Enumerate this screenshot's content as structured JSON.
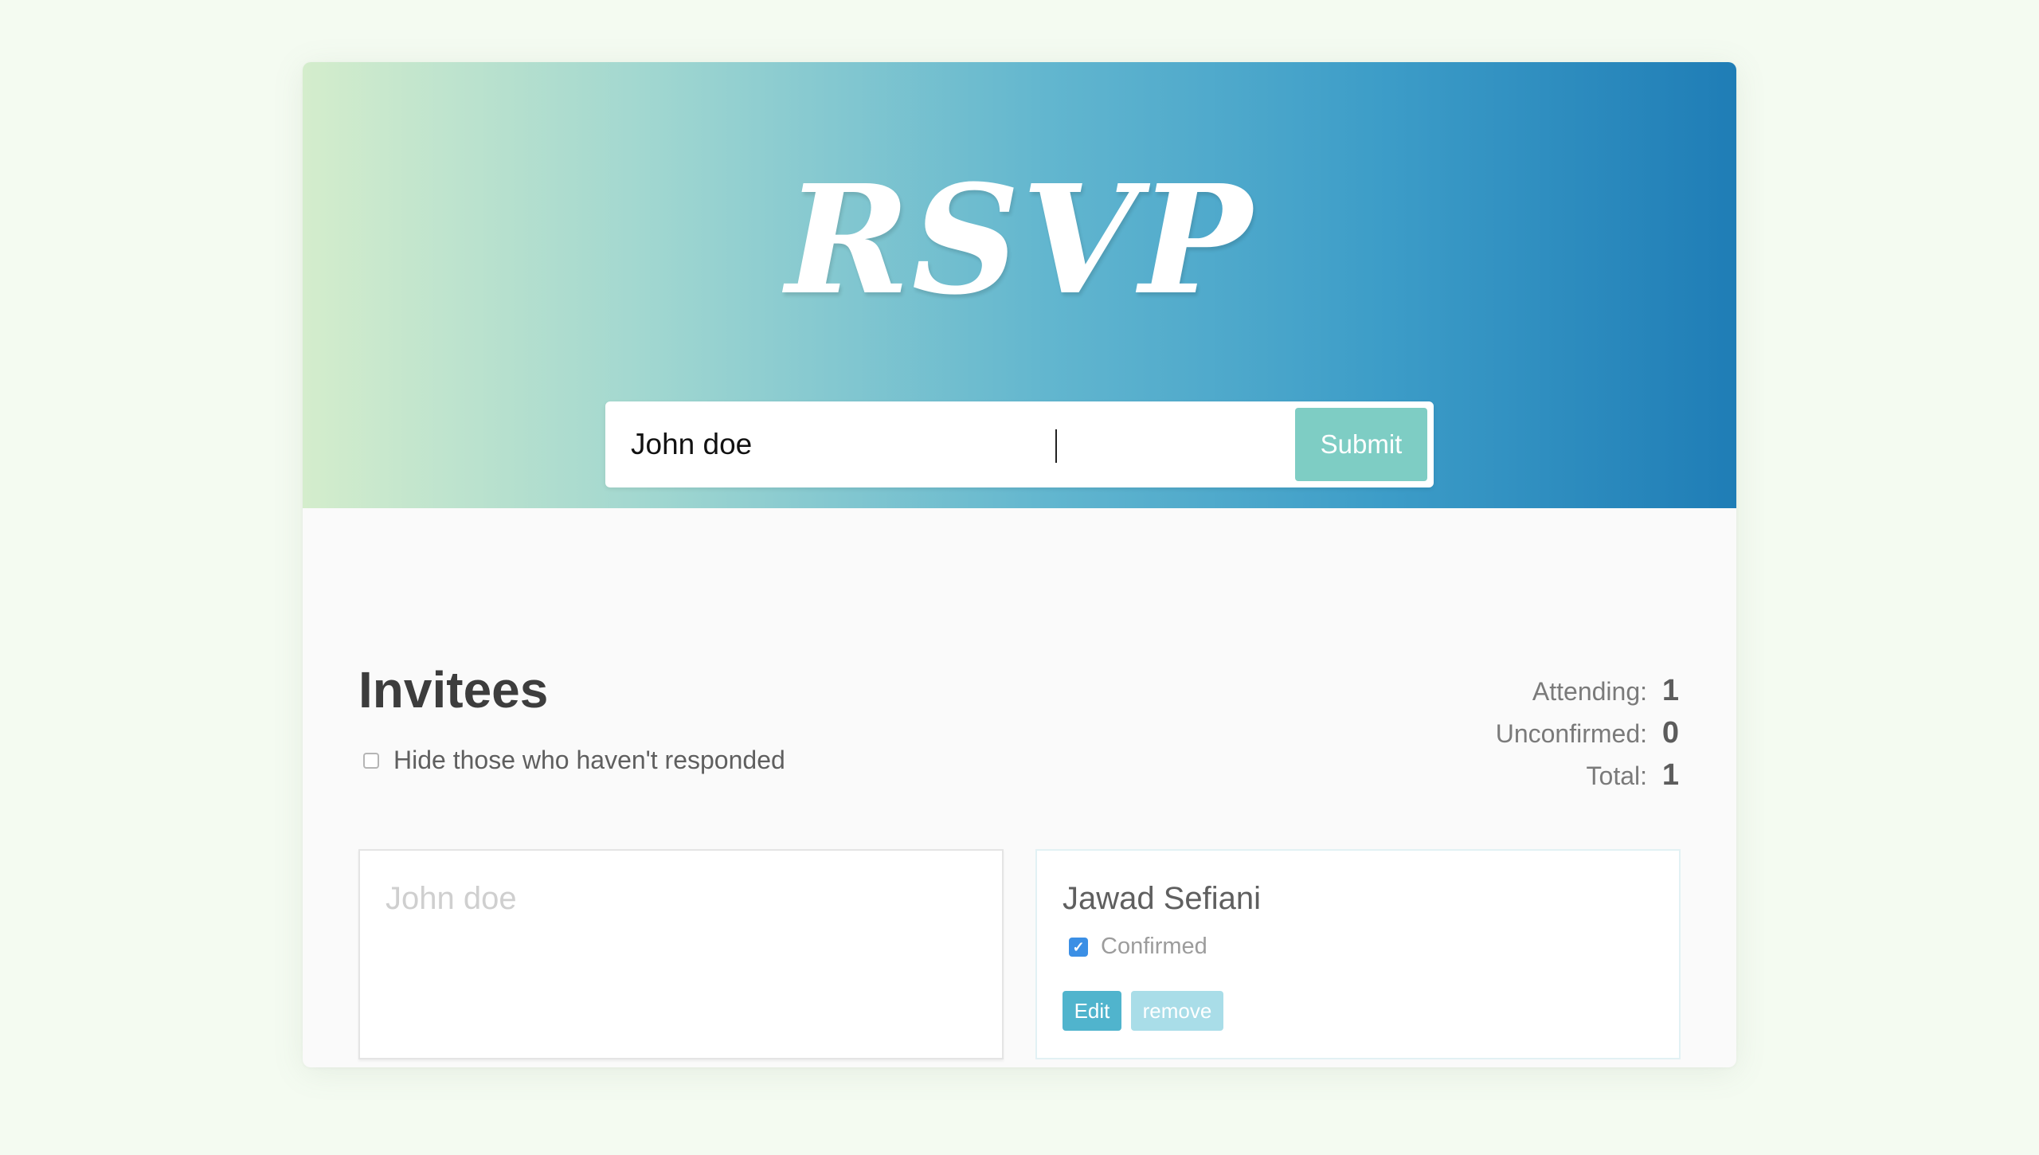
{
  "header": {
    "logo_text": "RSVP"
  },
  "form": {
    "input_value": "John doe",
    "submit_label": "Submit"
  },
  "main": {
    "title": "Invitees",
    "filter_label": "Hide those who haven't responded",
    "filter_checked": false
  },
  "counter": {
    "attending_label": "Attending:",
    "attending_value": "1",
    "unconfirmed_label": "Unconfirmed:",
    "unconfirmed_value": "0",
    "total_label": "Total:",
    "total_value": "1"
  },
  "invitees": {
    "pending": {
      "name": "John doe"
    },
    "guest": {
      "name": "Jawad Sefiani",
      "confirmed": true,
      "confirmed_label": "Confirmed",
      "edit_label": "Edit",
      "remove_label": "remove"
    }
  },
  "colors": {
    "gradient_start": "#d4edcc",
    "gradient_end": "#1f7db6",
    "submit": "#7ecdc4",
    "edit": "#50b4cd",
    "remove": "#a9dde8",
    "checkbox": "#3b8fe5"
  },
  "icons": {
    "checkbox_checked": "check-icon"
  }
}
